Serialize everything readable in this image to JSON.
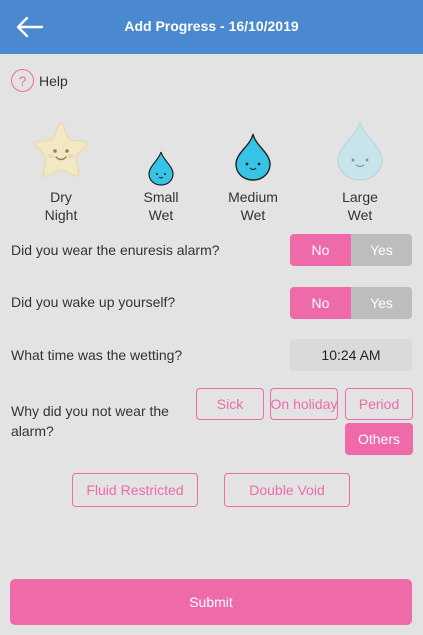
{
  "header": {
    "title": "Add Progress - 16/10/2019"
  },
  "help": {
    "label": "Help",
    "icon": "help-circle-icon",
    "symbol": "?"
  },
  "wet_options": [
    {
      "line1": "Dry",
      "line2": "Night",
      "icon": "star-icon"
    },
    {
      "line1": "Small",
      "line2": "Wet",
      "icon": "small-drop-icon"
    },
    {
      "line1": "Medium",
      "line2": "Wet",
      "icon": "medium-drop-icon"
    },
    {
      "line1": "Large",
      "line2": "Wet",
      "icon": "large-drop-icon"
    }
  ],
  "questions": {
    "alarm": {
      "label": "Did you wear the enuresis alarm?",
      "no": "No",
      "yes": "Yes",
      "selected": "No"
    },
    "wake": {
      "label": "Did you wake up yourself?",
      "no": "No",
      "yes": "Yes",
      "selected": "No"
    },
    "time": {
      "label": "What time was the wetting?",
      "value": "10:24 AM"
    },
    "why": {
      "line1": "Why did you not wear the",
      "line2": "alarm?",
      "options": [
        "Sick",
        "On holiday",
        "Period",
        "Others"
      ],
      "selected": "Others"
    }
  },
  "extra_options": [
    "Fluid Restricted",
    "Double Void"
  ],
  "submit_label": "Submit",
  "colors": {
    "accent": "#ef6aa8",
    "header": "#4a88d0",
    "background": "#e3e3e3",
    "toggle_off": "#bdbdbd"
  }
}
